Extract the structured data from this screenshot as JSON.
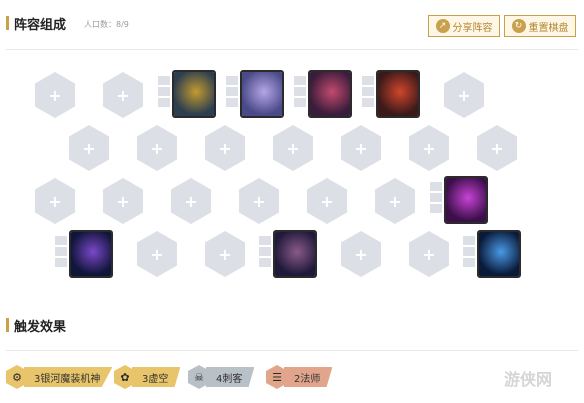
{
  "header": {
    "title": "阵容组成",
    "population_label": "人口数：",
    "population_value": "8/9",
    "share_button": "分享阵容",
    "reset_button": "重置棋盘"
  },
  "board": {
    "champions": [
      {
        "name": "champion-1",
        "colors": [
          "#2c3e50",
          "#c49a2f"
        ]
      },
      {
        "name": "champion-2",
        "colors": [
          "#4a4a88",
          "#b6a6e6"
        ]
      },
      {
        "name": "champion-3",
        "colors": [
          "#3a1c3c",
          "#c34a6e"
        ]
      },
      {
        "name": "champion-4",
        "colors": [
          "#3a1a1a",
          "#d2452d"
        ]
      },
      {
        "name": "champion-5",
        "colors": [
          "#3c0f4a",
          "#c743d6"
        ]
      },
      {
        "name": "champion-6",
        "colors": [
          "#10153a",
          "#7a48c8"
        ]
      },
      {
        "name": "champion-7",
        "colors": [
          "#201a3a",
          "#8a5a88"
        ]
      },
      {
        "name": "champion-8",
        "colors": [
          "#0a1a3a",
          "#4a9ae6"
        ]
      }
    ],
    "empty_slot_symbol": "+"
  },
  "traits_section": {
    "title": "触发效果",
    "traits": [
      {
        "label": "3银河魔装机神",
        "tier": "gold",
        "icon": "mech-icon"
      },
      {
        "label": "3虚空",
        "tier": "gold",
        "icon": "void-icon"
      },
      {
        "label": "4刺客",
        "tier": "silver",
        "icon": "assassin-icon"
      },
      {
        "label": "2法师",
        "tier": "bronze",
        "icon": "sorcerer-icon"
      }
    ]
  },
  "watermark": {
    "text": "游侠网"
  }
}
